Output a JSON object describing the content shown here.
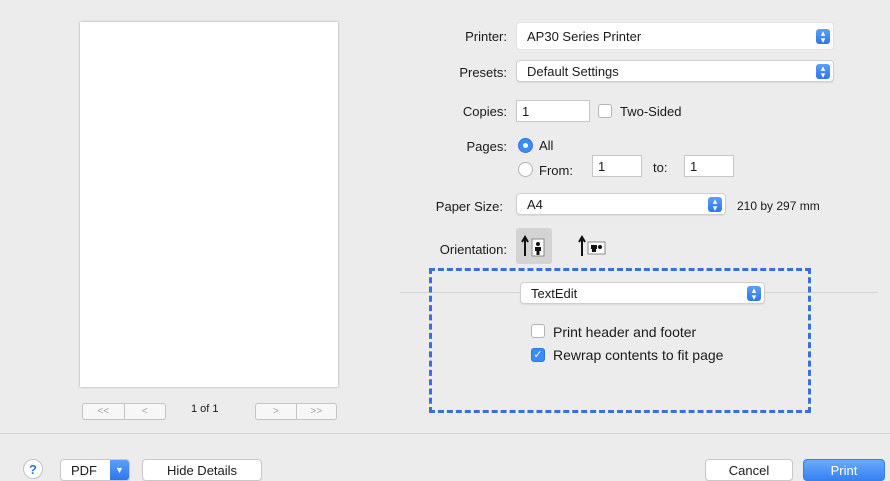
{
  "printer": {
    "label": "Printer:",
    "value": "AP30 Series Printer"
  },
  "presets": {
    "label": "Presets:",
    "value": "Default Settings"
  },
  "copies": {
    "label": "Copies:",
    "value": "1",
    "two_sided_label": "Two-Sided"
  },
  "pages": {
    "label": "Pages:",
    "all_label": "All",
    "from_label": "From:",
    "from_value": "1",
    "to_label": "to:",
    "to_value": "1"
  },
  "paper_size": {
    "label": "Paper Size:",
    "value": "A4",
    "dimensions": "210 by 297 mm"
  },
  "orientation": {
    "label": "Orientation:"
  },
  "app_options": {
    "selected_panel": "TextEdit",
    "print_header_footer_label": "Print header and footer",
    "print_header_footer_checked": false,
    "rewrap_label": "Rewrap contents to fit page",
    "rewrap_checked": true
  },
  "preview": {
    "page_count": "1 of 1"
  },
  "footer": {
    "help_label": "?",
    "pdf_label": "PDF",
    "hide_details_label": "Hide Details",
    "cancel_label": "Cancel",
    "print_label": "Print"
  },
  "colors": {
    "accent": "#3b8cf7",
    "highlight_box": "#3a6fdc"
  }
}
